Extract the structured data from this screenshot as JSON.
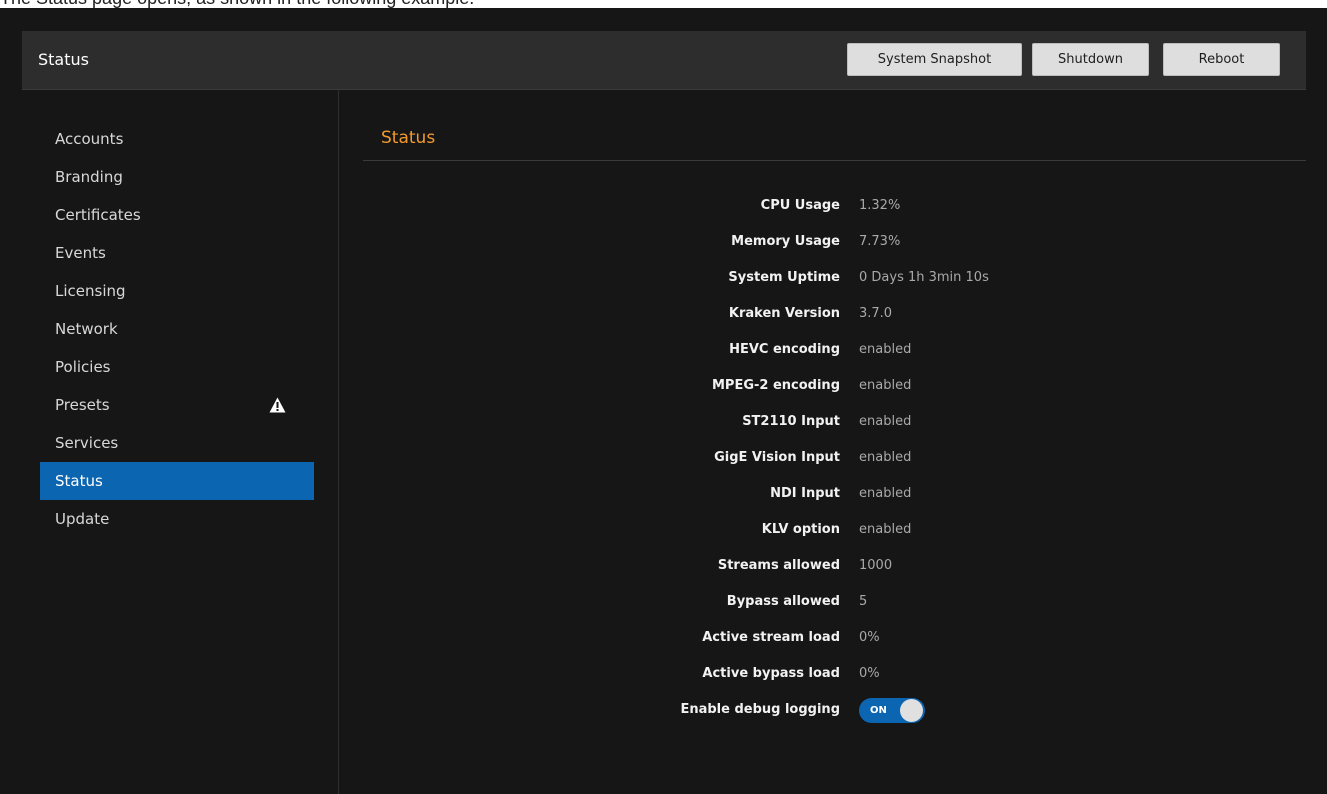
{
  "caption": "The Status page opens, as shown in the following example.",
  "header": {
    "title": "Status",
    "buttons": {
      "snapshot": "System Snapshot",
      "shutdown": "Shutdown",
      "reboot": "Reboot"
    }
  },
  "sidebar": {
    "items": [
      {
        "label": "Accounts"
      },
      {
        "label": "Branding"
      },
      {
        "label": "Certificates"
      },
      {
        "label": "Events"
      },
      {
        "label": "Licensing"
      },
      {
        "label": "Network"
      },
      {
        "label": "Policies"
      },
      {
        "label": "Presets",
        "icon": "warning-icon"
      },
      {
        "label": "Services"
      },
      {
        "label": "Status",
        "active": true
      },
      {
        "label": "Update"
      }
    ]
  },
  "main": {
    "section_title": "Status",
    "rows": [
      {
        "label": "CPU Usage",
        "value": "1.32%"
      },
      {
        "label": "Memory Usage",
        "value": "7.73%"
      },
      {
        "label": "System Uptime",
        "value": "0 Days 1h 3min 10s"
      },
      {
        "label": "Kraken Version",
        "value": "3.7.0"
      },
      {
        "label": "HEVC encoding",
        "value": "enabled"
      },
      {
        "label": "MPEG-2 encoding",
        "value": "enabled"
      },
      {
        "label": "ST2110 Input",
        "value": "enabled"
      },
      {
        "label": "GigE Vision Input",
        "value": "enabled"
      },
      {
        "label": "NDI Input",
        "value": "enabled"
      },
      {
        "label": "KLV option",
        "value": "enabled"
      },
      {
        "label": "Streams allowed",
        "value": "1000"
      },
      {
        "label": "Bypass allowed",
        "value": "5"
      },
      {
        "label": "Active stream load",
        "value": "0%"
      },
      {
        "label": "Active bypass load",
        "value": "0%"
      }
    ],
    "debug_logging": {
      "label": "Enable debug logging",
      "state": "ON"
    }
  },
  "colors": {
    "accent": "#0c65b0",
    "section_title": "#f39a2c",
    "background": "#161616"
  }
}
